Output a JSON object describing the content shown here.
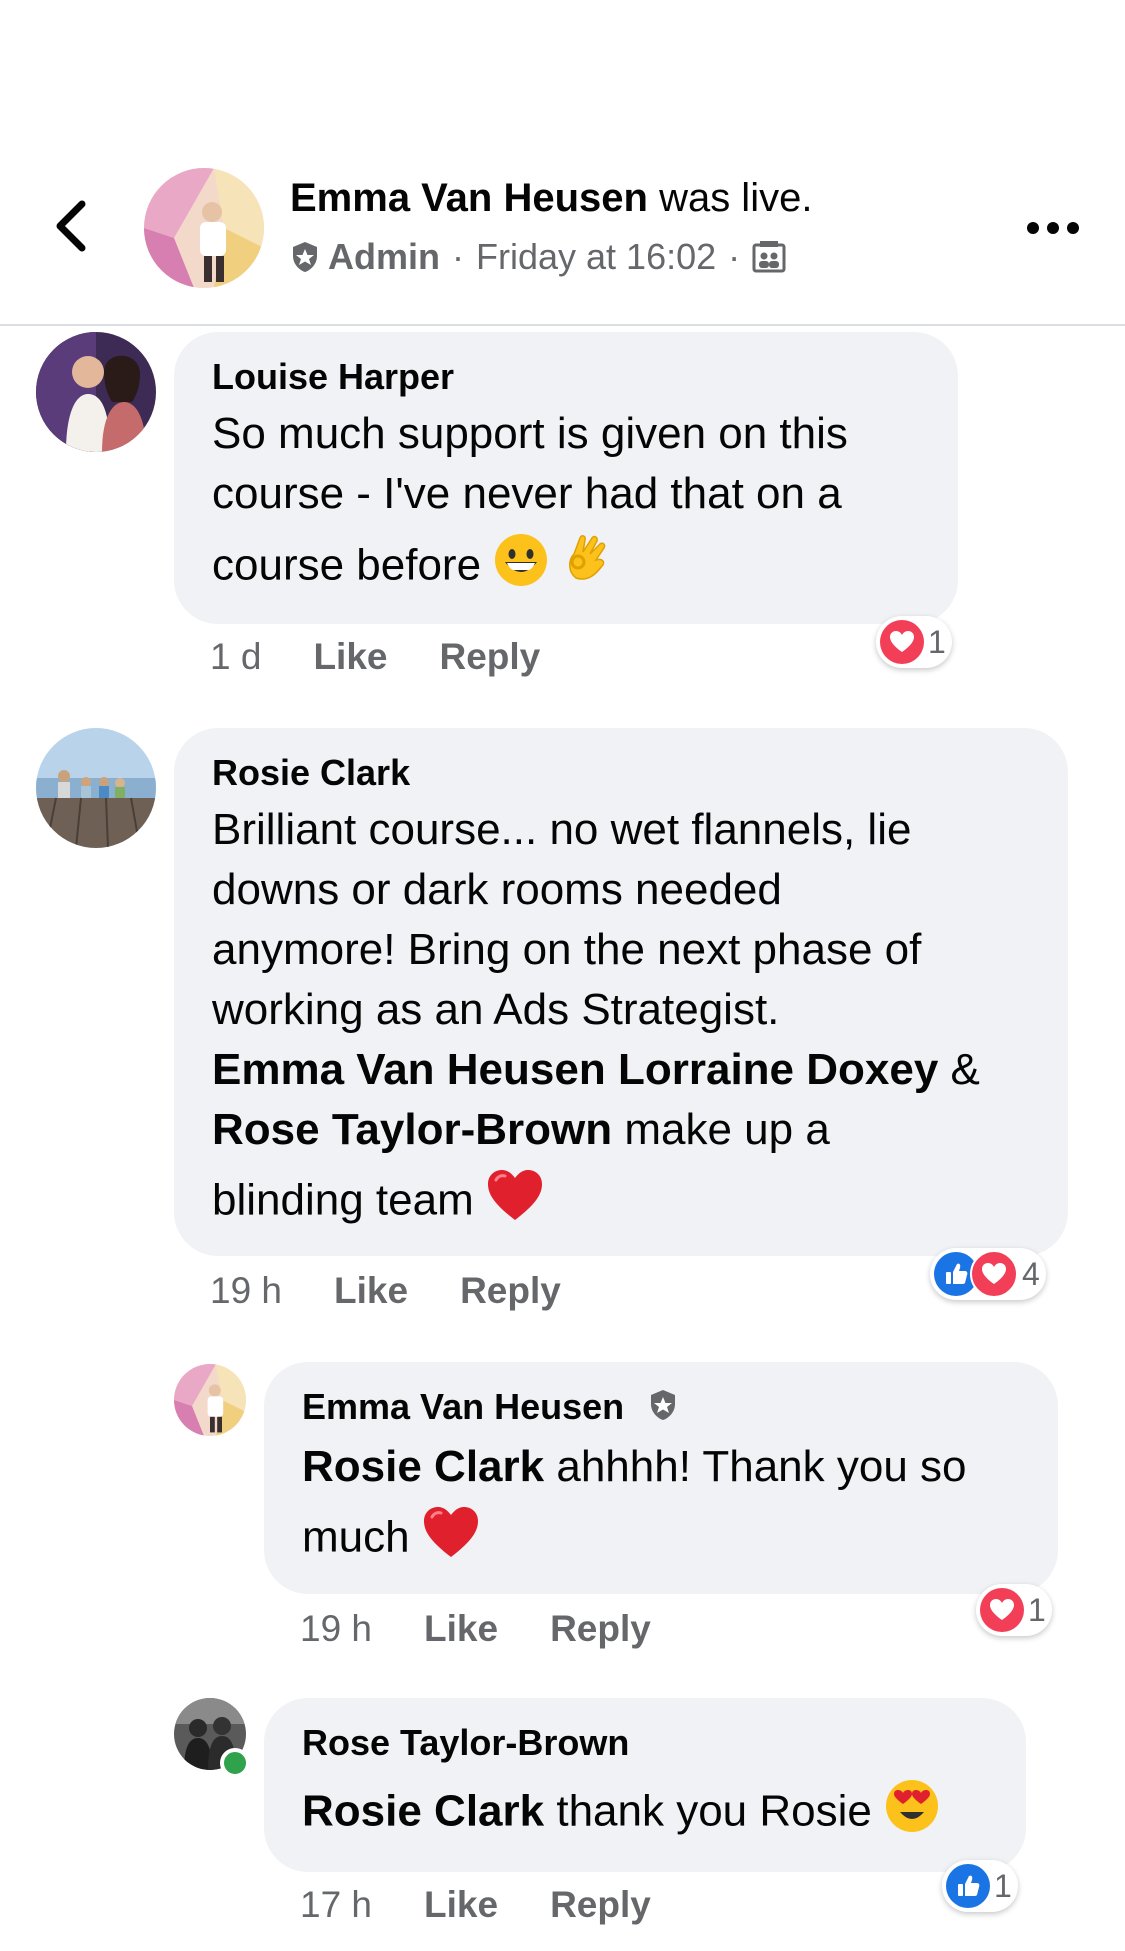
{
  "header": {
    "author": "Emma Van Heusen",
    "action": "was live.",
    "role": "Admin",
    "separator": "·",
    "timestamp": "Friday at 16:02",
    "privacy_icon": "group-icon"
  },
  "comments": [
    {
      "name": "Louise Harper",
      "text_lines": [
        "So much support is given on this",
        "course - I've never had that on a",
        "course before"
      ],
      "emojis": [
        "grinning-face-emoji",
        "ok-hand-emoji"
      ],
      "time": "1 d",
      "like_label": "Like",
      "reply_label": "Reply",
      "reactions": [
        "love"
      ],
      "reaction_count": "1"
    },
    {
      "name": "Rosie Clark",
      "text_lines": [
        "Brilliant course... no wet flannels, lie",
        "downs or dark rooms needed",
        "anymore! Bring on the next phase of",
        "working as an Ads Strategist."
      ],
      "mention1": "Emma Van Heusen",
      "mention2": "Lorraine Doxey",
      "amp": "&",
      "mention3": "Rose Taylor-Brown",
      "tail1": "make up a",
      "tail2": "blinding team",
      "emojis": [
        "red-heart-emoji"
      ],
      "time": "19 h",
      "like_label": "Like",
      "reply_label": "Reply",
      "reactions": [
        "like",
        "love"
      ],
      "reaction_count": "4"
    }
  ],
  "replies": [
    {
      "name": "Emma Van Heusen",
      "mention": "Rosie Clark",
      "text1": "ahhhh! Thank you so",
      "text2": "much",
      "emojis": [
        "red-heart-emoji"
      ],
      "time": "19 h",
      "like_label": "Like",
      "reply_label": "Reply",
      "reactions": [
        "love"
      ],
      "reaction_count": "1"
    },
    {
      "name": "Rose Taylor-Brown",
      "mention": "Rosie Clark",
      "text1": "thank you Rosie",
      "emojis": [
        "heart-eyes-emoji"
      ],
      "time": "17 h",
      "like_label": "Like",
      "reply_label": "Reply",
      "reactions": [
        "like"
      ],
      "reaction_count": "1"
    }
  ],
  "colors": {
    "bubble": "#f0f2f5",
    "secondary_text": "#65676b",
    "love": "#f33e58",
    "like": "#1b74e4",
    "online": "#31a24c"
  }
}
